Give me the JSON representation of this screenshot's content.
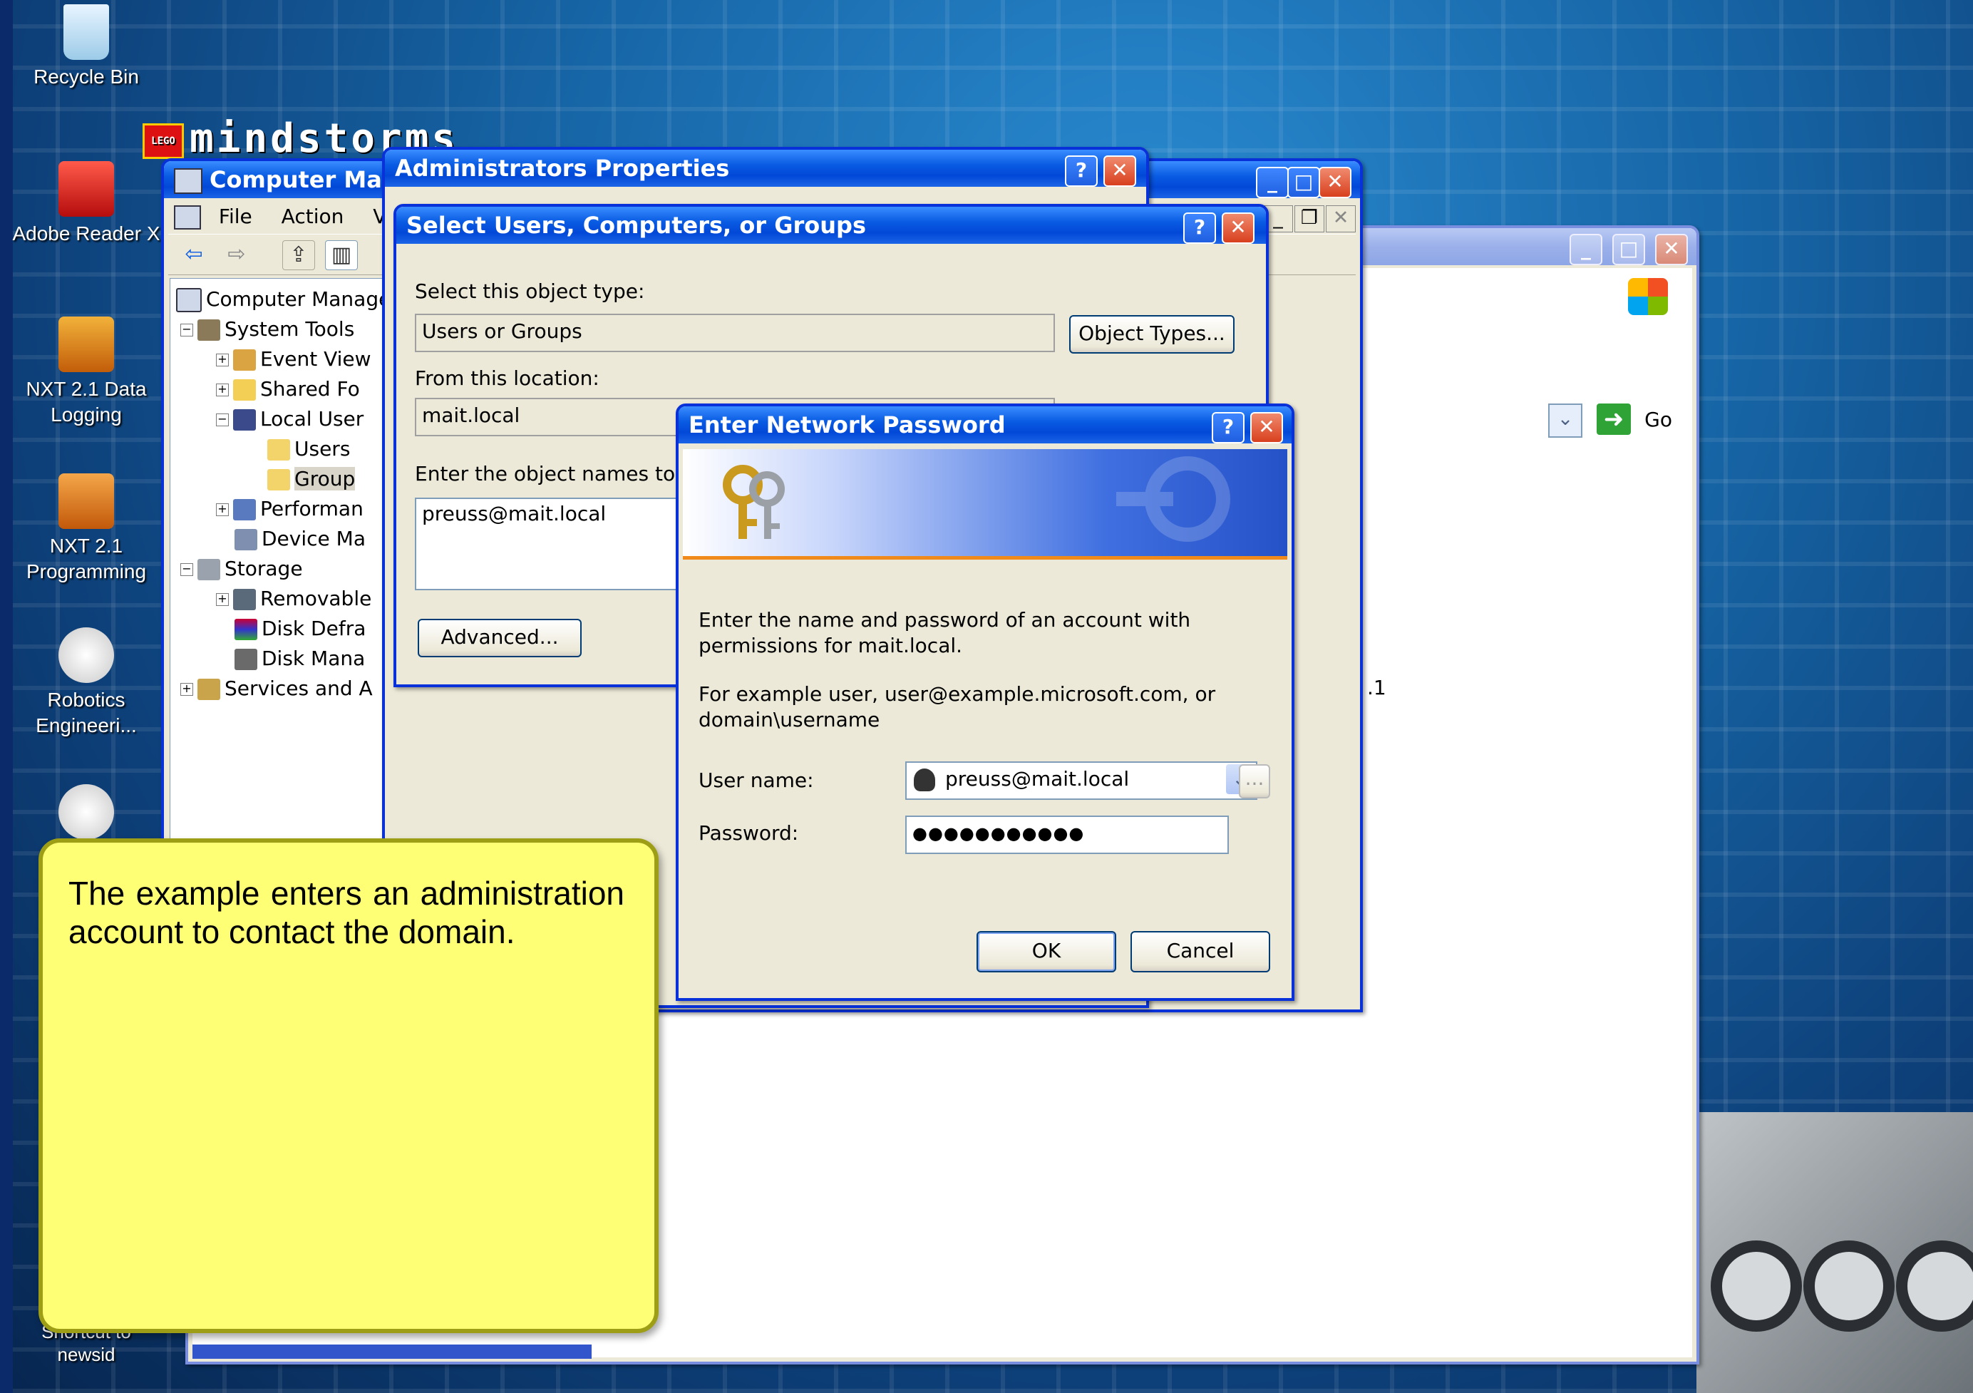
{
  "desktop": {
    "icons": [
      {
        "label": "Recycle Bin"
      },
      {
        "label": "Adobe Reader X"
      },
      {
        "label": "NXT 2.1 Data Logging"
      },
      {
        "label": "NXT 2.1 Programming"
      },
      {
        "label": "Robotics Engineeri..."
      },
      {
        "label": "Shortcut to newsid"
      }
    ],
    "banner_text": "mindstorms",
    "banner_brand": "LEGO"
  },
  "computer_management": {
    "title": "Computer Mana",
    "menu": [
      "File",
      "Action",
      "Vi"
    ],
    "tree": [
      {
        "label": "Computer Manage"
      },
      {
        "label": "System Tools"
      },
      {
        "label": "Event View"
      },
      {
        "label": "Shared Fo"
      },
      {
        "label": "Local User"
      },
      {
        "label": "Users"
      },
      {
        "label": "Group"
      },
      {
        "label": "Performan"
      },
      {
        "label": "Device Ma"
      },
      {
        "label": "Storage"
      },
      {
        "label": "Removable"
      },
      {
        "label": "Disk Defra"
      },
      {
        "label": "Disk Mana"
      },
      {
        "label": "Services and A"
      }
    ]
  },
  "back_window": {
    "go_label": "Go",
    "fragment": ".1"
  },
  "admin_props": {
    "title": "Administrators Properties"
  },
  "select_users": {
    "title": "Select Users, Computers, or Groups",
    "object_type_label": "Select this object type:",
    "object_type_value": "Users or Groups",
    "object_types_button": "Object Types...",
    "location_label": "From this location:",
    "location_value": "mait.local",
    "names_label": "Enter the object names to sel",
    "names_value": "preuss@mait.local",
    "advanced_button": "Advanced..."
  },
  "network_password": {
    "title": "Enter Network Password",
    "message1": "Enter the name and password of an account with permissions for mait.local.",
    "message2": "For example user, user@example.microsoft.com, or domain\\username",
    "username_label": "User name:",
    "username_value": "preuss@mait.local",
    "password_label": "Password:",
    "password_value": "●●●●●●●●●●●",
    "browse_button": "...",
    "ok_button": "OK",
    "cancel_button": "Cancel"
  },
  "callout": {
    "text": "The example enters an administration account to contact the domain."
  }
}
